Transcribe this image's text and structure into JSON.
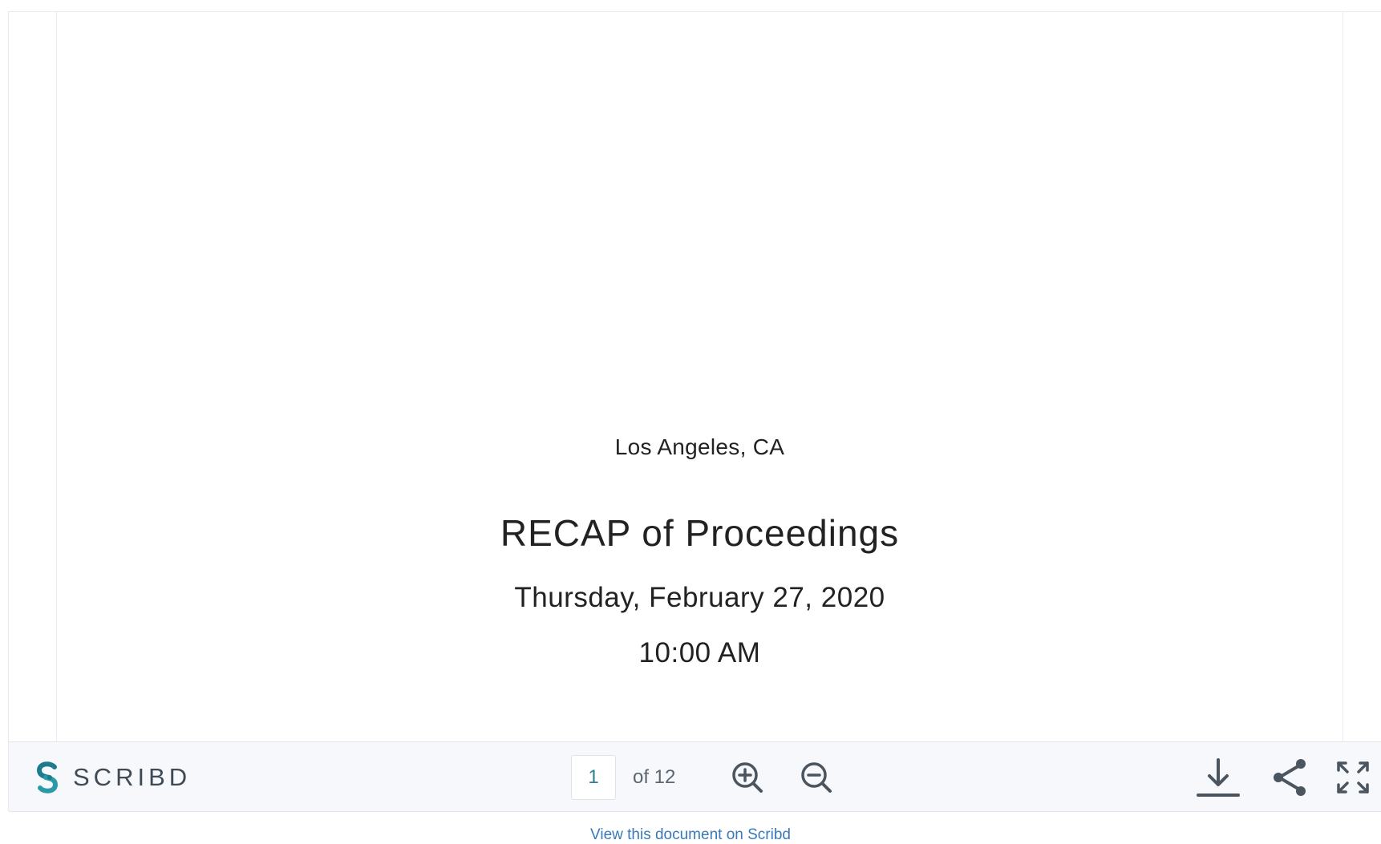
{
  "document": {
    "location": "Los Angeles, CA",
    "title": "RECAP of Proceedings",
    "date": "Thursday, February 27, 2020",
    "time": "10:00 AM"
  },
  "toolbar": {
    "brand_name": "SCRIBD",
    "logo_icon": "scribd-logo-icon",
    "current_page": "1",
    "page_count_label": "of 12",
    "icons": {
      "zoom_in": "zoom-in-icon",
      "zoom_out": "zoom-out-icon",
      "download": "download-icon",
      "share": "share-icon",
      "fullscreen": "fullscreen-icon"
    },
    "colors": {
      "brand_teal": "#1e7a8c",
      "icon_gray": "#4a5560",
      "toolbar_bg": "#f6f8fb"
    }
  },
  "footer": {
    "link_text": "View this document on Scribd"
  }
}
